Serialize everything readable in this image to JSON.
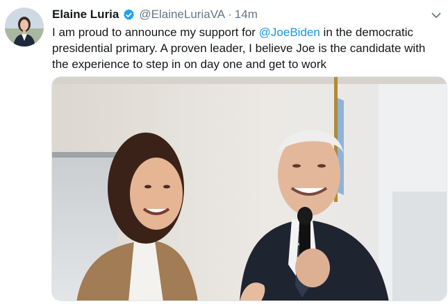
{
  "tweet": {
    "display_name": "Elaine Luria",
    "handle": "@ElaineLuriaVA",
    "separator": "·",
    "time": "14m",
    "text": {
      "before_mention": "I am proud to announce my support for ",
      "mention": "@JoeBiden",
      "after_mention": " in the democratic presidential primary. A proven leader, I believe Joe is the candidate with the experience to step in on day one and get to work"
    }
  },
  "icons": {
    "verified": "verified-badge-icon",
    "caret": "chevron-down-icon"
  },
  "colors": {
    "link": "#1b95e0",
    "verified": "#1da1f2",
    "secondary_text": "#657786"
  }
}
